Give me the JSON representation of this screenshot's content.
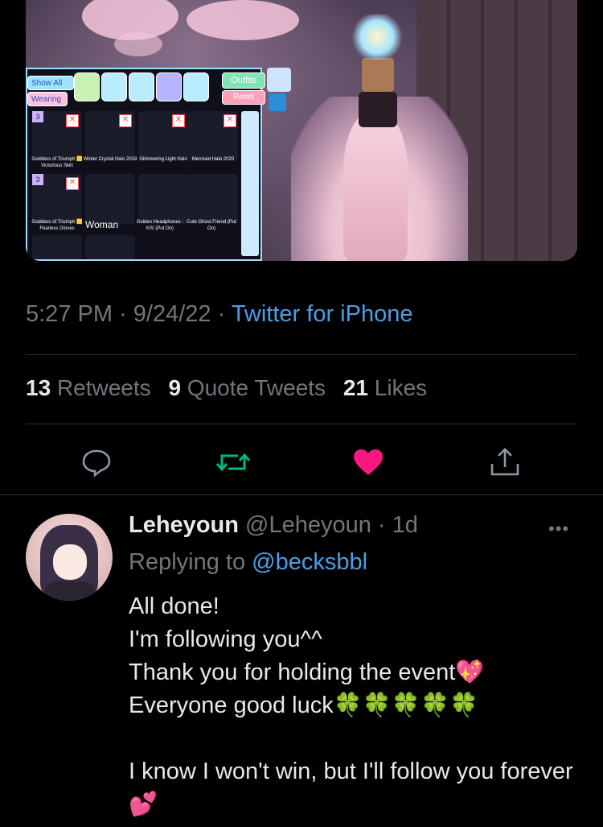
{
  "media": {
    "panel": {
      "show_all": "Show All",
      "wearing": "Wearing",
      "outfits": "Outfits",
      "reset": "Reset",
      "items": [
        {
          "name": "Goddess of Triumph 🟨 Victorious Skirt",
          "badge": "3"
        },
        {
          "name": "Winter Crystal Halo 2018"
        },
        {
          "name": "Glimmering Light Halo"
        },
        {
          "name": "Mermaid Halo 2020"
        },
        {
          "name": "Goddess of Triumph 🟨 Fearless Gloves",
          "badge": "3"
        },
        {
          "name": "Woman"
        },
        {
          "name": "Golden Headphones - KSI (Put On)"
        },
        {
          "name": "Cute Ghost Friend (Put On)"
        }
      ]
    }
  },
  "tweet": {
    "time": "5:27 PM",
    "date": "9/24/22",
    "source": "Twitter for iPhone",
    "retweets_count": "13",
    "retweets_label": "Retweets",
    "quotes_count": "9",
    "quotes_label": "Quote Tweets",
    "likes_count": "21",
    "likes_label": "Likes",
    "colors": {
      "like": "#f91880",
      "retweet": "#00ba7c",
      "link": "#4d9ee6"
    }
  },
  "reply": {
    "name": "Leheyoun",
    "handle": "@Leheyoun",
    "age": "1d",
    "replying_prefix": "Replying to",
    "replying_to": "@becksbbl",
    "text": "All done!\nI'm following you^^\nThank you for holding the event💖\nEveryone good luck🍀🍀🍀🍀🍀\n\nI know I won't win, but I'll follow you forever💕"
  }
}
